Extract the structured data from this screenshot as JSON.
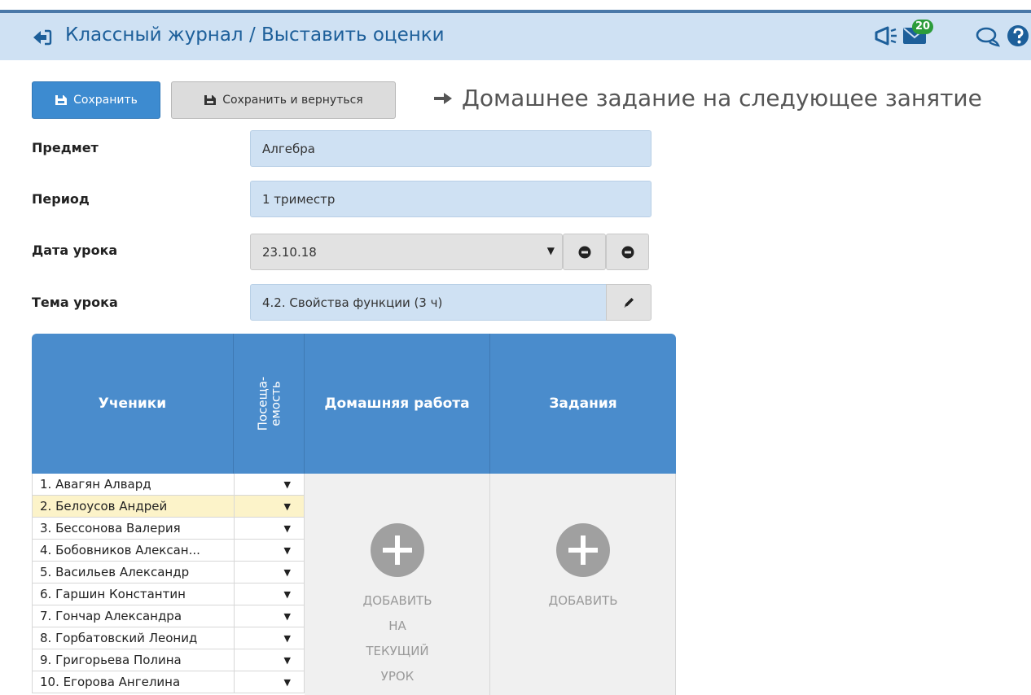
{
  "header": {
    "title": "Классный журнал / Выставить оценки",
    "messages_count": "20"
  },
  "toolbar": {
    "save_label": "Сохранить",
    "save_return_label": "Сохранить и вернуться",
    "homework_link": "Домашнее задание на следующее занятие"
  },
  "form": {
    "subject": {
      "label": "Предмет",
      "value": "Алгебра"
    },
    "period": {
      "label": "Период",
      "value": "1 триместр"
    },
    "lesson_date": {
      "label": "Дата урока",
      "value": "23.10.18"
    },
    "lesson_topic": {
      "label": "Тема урока",
      "value": "4.2. Свойства функции (3 ч)"
    }
  },
  "table": {
    "headers": {
      "students": "Ученики",
      "attendance": "Посеща-емость",
      "homework": "Домашняя работа",
      "tasks": "Задания"
    },
    "dropdown_glyph": "▼",
    "students": [
      "1. Авагян Алвард",
      "2. Белоусов Андрей",
      "3. Бессонова Валерия",
      "4. Бобовников Алексан...",
      "5. Васильев Александр",
      "6. Гаршин Константин",
      "7. Гончар Александра",
      "8. Горбатовский Леонид",
      "9. Григорьева Полина",
      "10. Егорова Ангелина"
    ],
    "highlighted_row": 2,
    "homework_add_lines": [
      "ДОБАВИТЬ",
      "НА",
      "ТЕКУЩИЙ",
      "УРОК"
    ],
    "tasks_add": "ДОБАВИТЬ"
  },
  "icons": {
    "back": "back-arrow-icon",
    "announce": "megaphone-icon",
    "mail": "mail-icon",
    "chat": "chat-icon",
    "help": "help-icon",
    "save": "save-icon",
    "arrow": "arrow-right-icon",
    "prev": "prev-circle-icon",
    "next": "next-circle-icon",
    "edit": "pencil-icon",
    "add": "plus-circle-icon"
  },
  "colors": {
    "header_bg": "#cfe1f3",
    "title": "#1d5f9a",
    "primary_button": "#3d8bd0",
    "table_header": "#4a8ccc",
    "highlight_row": "#fcf3c9",
    "badge": "#2c9c3a"
  }
}
